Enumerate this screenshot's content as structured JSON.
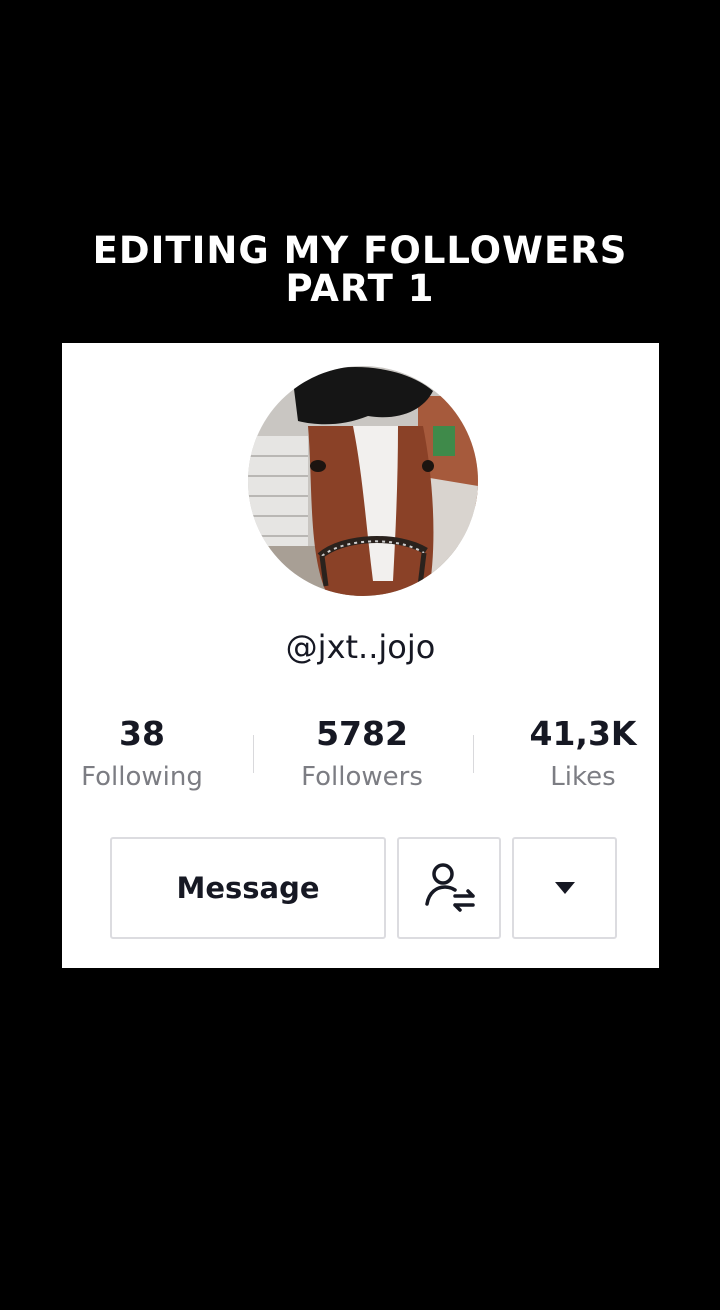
{
  "caption": {
    "line1": "EDITING MY FOLLOWERS",
    "line2": "PART 1"
  },
  "profile": {
    "username": "@jxt..jojo",
    "avatar_icon": "horse-profile-photo"
  },
  "stats": [
    {
      "value": "38",
      "label": "Following"
    },
    {
      "value": "5782",
      "label": "Followers"
    },
    {
      "value": "41,3K",
      "label": "Likes"
    }
  ],
  "actions": {
    "message_label": "Message",
    "follow_switch_icon": "user-swap-icon",
    "more_icon": "caret-down-icon"
  },
  "colors": {
    "background": "#000000",
    "card": "#ffffff",
    "text_primary": "#161823",
    "text_secondary": "#7c7d83",
    "border": "#dcdce0"
  }
}
